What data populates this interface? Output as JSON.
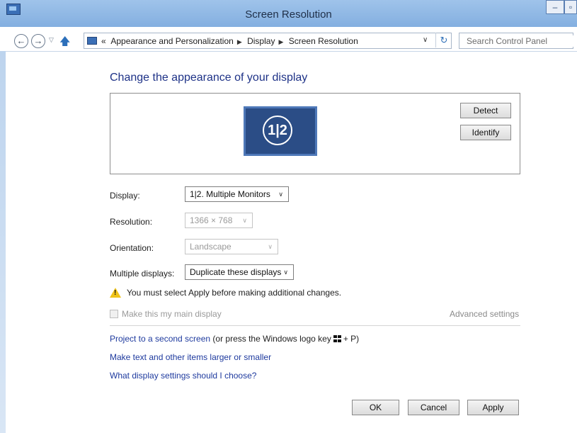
{
  "window": {
    "title": "Screen Resolution"
  },
  "nav": {
    "breadcrumbs": [
      "Appearance and Personalization",
      "Display",
      "Screen Resolution"
    ],
    "search_placeholder": "Search Control Panel"
  },
  "main": {
    "heading": "Change the appearance of your display",
    "monitor_label_left": "1",
    "monitor_label_right": "2",
    "detect_label": "Detect",
    "identify_label": "Identify",
    "display_label": "Display:",
    "display_value": "1|2. Multiple Monitors",
    "resolution_label": "Resolution:",
    "resolution_value": "1366 × 768",
    "orientation_label": "Orientation:",
    "orientation_value": "Landscape",
    "multiple_label": "Multiple displays:",
    "multiple_value": "Duplicate these displays",
    "warning": "You must select Apply before making additional changes.",
    "main_display_checkbox": "Make this my main display",
    "advanced_link": "Advanced settings",
    "project_link": "Project to a second screen",
    "project_suffix_a": "(or press the Windows logo key",
    "project_suffix_b": "+ P)",
    "larger_link": "Make text and other items larger or smaller",
    "choose_link": "What display settings should I choose?"
  },
  "buttons": {
    "ok": "OK",
    "cancel": "Cancel",
    "apply": "Apply"
  },
  "icons": {
    "back": "back-arrow-icon",
    "forward": "forward-arrow-icon",
    "up": "up-arrow-icon",
    "refresh": "refresh-icon",
    "warning": "warning-icon"
  }
}
